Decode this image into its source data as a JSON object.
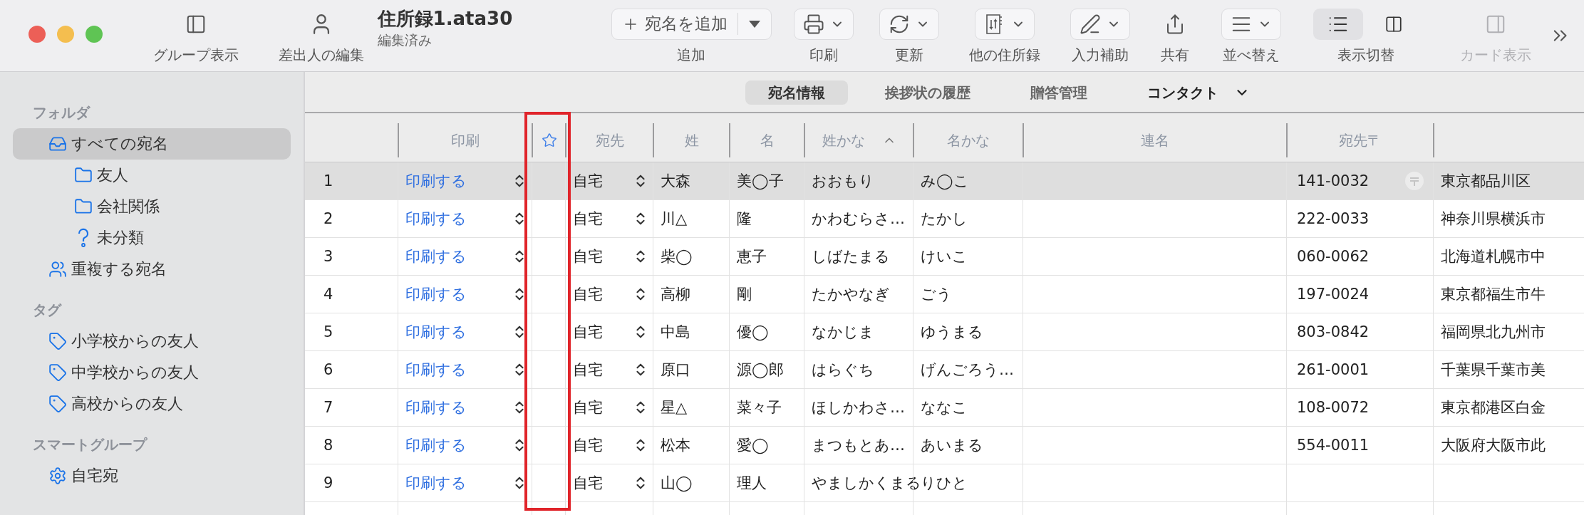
{
  "window": {
    "title": "住所録1.ata30",
    "subtitle": "編集済み"
  },
  "toolbar": {
    "left": [
      {
        "kind": "sidebar",
        "label": "グループ表示"
      },
      {
        "kind": "sender",
        "label": "差出人の編集"
      }
    ],
    "items": [
      {
        "kind": "add",
        "text": "宛名を追加",
        "label": "追加"
      },
      {
        "kind": "print",
        "label": "印刷"
      },
      {
        "kind": "refresh",
        "label": "更新"
      },
      {
        "kind": "books",
        "label": "他の住所録"
      },
      {
        "kind": "assist",
        "label": "入力補助"
      },
      {
        "kind": "share",
        "label": "共有"
      },
      {
        "kind": "sort",
        "label": "並べ替え"
      }
    ],
    "view_toggle": {
      "label": "表示切替",
      "options": [
        {
          "kind": "list",
          "selected": true
        },
        {
          "kind": "columns",
          "selected": false
        }
      ]
    },
    "card_view": {
      "label": "カード表示",
      "disabled": true
    }
  },
  "sidebar": {
    "sections": [
      {
        "heading": "フォルダ",
        "items": [
          {
            "kind": "inbox",
            "label": "すべての宛名",
            "selected": true,
            "children": [
              {
                "kind": "folder",
                "label": "友人",
                "selected": false
              },
              {
                "kind": "folder",
                "label": "会社関係",
                "selected": false
              },
              {
                "kind": "unsorted",
                "label": "未分類",
                "selected": false
              }
            ]
          },
          {
            "kind": "duplicates",
            "label": "重複する宛名",
            "selected": false
          }
        ]
      },
      {
        "heading": "タグ",
        "items": [
          {
            "kind": "tag",
            "label": "小学校からの友人",
            "selected": false
          },
          {
            "kind": "tag",
            "label": "中学校からの友人",
            "selected": false
          },
          {
            "kind": "tag",
            "label": "高校からの友人",
            "selected": false
          }
        ]
      },
      {
        "heading": "スマートグループ",
        "items": [
          {
            "kind": "smart",
            "label": "自宅宛",
            "selected": false
          }
        ]
      }
    ]
  },
  "tabs": [
    {
      "kind": "tab",
      "label": "宛名情報",
      "selected": true
    },
    {
      "kind": "tab",
      "label": "挨拶状の履歴",
      "selected": false
    },
    {
      "kind": "tab",
      "label": "贈答管理",
      "selected": false
    },
    {
      "kind": "menu",
      "label": "コンタクト",
      "selected": false
    }
  ],
  "table": {
    "highlight_star_column": true,
    "columns": [
      {
        "kind": "text",
        "label": "印刷"
      },
      {
        "kind": "star"
      },
      {
        "kind": "text",
        "label": "宛先"
      },
      {
        "kind": "text",
        "label": "姓"
      },
      {
        "kind": "text",
        "label": "名"
      },
      {
        "kind": "text",
        "label": "姓かな",
        "sorted_ascending": true
      },
      {
        "kind": "text",
        "label": "名かな"
      },
      {
        "kind": "text",
        "label": "連名"
      },
      {
        "kind": "text",
        "label": "宛先〒"
      }
    ],
    "rows": [
      {
        "number": "1",
        "print": "印刷する",
        "destination": "自宅",
        "last": "大森",
        "first": "美◯子",
        "last_kana": "おおもり",
        "first_kana": "み◯こ",
        "postal": "141-0032",
        "address": "東京都品川区",
        "selected": true
      },
      {
        "number": "2",
        "print": "印刷する",
        "destination": "自宅",
        "last": "川△",
        "first": "隆",
        "last_kana": "かわむらさ…",
        "first_kana": "たかし",
        "postal": "222-0033",
        "address": "神奈川県横浜市",
        "selected": false
      },
      {
        "number": "3",
        "print": "印刷する",
        "destination": "自宅",
        "last": "柴◯",
        "first": "恵子",
        "last_kana": "しばたまる",
        "first_kana": "けいこ",
        "postal": "060-0062",
        "address": "北海道札幌市中",
        "selected": false
      },
      {
        "number": "4",
        "print": "印刷する",
        "destination": "自宅",
        "last": "高柳",
        "first": "剛",
        "last_kana": "たかやなぎ",
        "first_kana": "ごう",
        "postal": "197-0024",
        "address": "東京都福生市牛",
        "selected": false
      },
      {
        "number": "5",
        "print": "印刷する",
        "destination": "自宅",
        "last": "中島",
        "first": "優◯",
        "last_kana": "なかじま",
        "first_kana": "ゆうまる",
        "postal": "803-0842",
        "address": "福岡県北九州市",
        "selected": false
      },
      {
        "number": "6",
        "print": "印刷する",
        "destination": "自宅",
        "last": "原口",
        "first": "源◯郎",
        "last_kana": "はらぐち",
        "first_kana": "げんごろう…",
        "postal": "261-0001",
        "address": "千葉県千葉市美",
        "selected": false
      },
      {
        "number": "7",
        "print": "印刷する",
        "destination": "自宅",
        "last": "星△",
        "first": "菜々子",
        "last_kana": "ほしかわさ…",
        "first_kana": "ななこ",
        "postal": "108-0072",
        "address": "東京都港区白金",
        "selected": false
      },
      {
        "number": "8",
        "print": "印刷する",
        "destination": "自宅",
        "last": "松本",
        "first": "愛◯",
        "last_kana": "まつもとあ…",
        "first_kana": "あいまる",
        "postal": "554-0011",
        "address": "大阪府大阪市此",
        "selected": false
      },
      {
        "number": "9",
        "print": "印刷する",
        "destination": "自宅",
        "last": "山◯",
        "first": "理人",
        "last_kana": "やましかくまる",
        "first_kana": "りひと",
        "selected": false
      }
    ]
  }
}
